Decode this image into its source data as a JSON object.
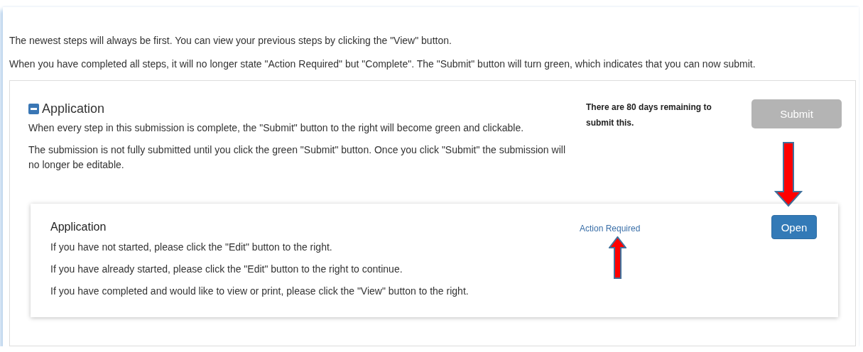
{
  "intro": [
    "The newest steps will always be first. You can view your previous steps by clicking the \"View\" button.",
    "When you have completed all steps, it will no longer state \"Action Required\" but \"Complete\". The \"Submit\" button will turn green, which indicates that you can now submit."
  ],
  "section": {
    "title": "Application",
    "expanded": true,
    "paragraphs": [
      "When every step in this submission is complete, the \"Submit\" button to the right will become green and clickable.",
      "The submission is not fully submitted until you click the green \"Submit\" button. Once you click \"Submit\" the submission will no longer be editable."
    ],
    "remaining": "There are 80 days remaining to submit this.",
    "submit": {
      "label": "Submit",
      "disabled": true
    }
  },
  "step": {
    "title": "Application",
    "lines": [
      "If you have not started, please click the \"Edit\" button to the right.",
      "If you have already started, please click the \"Edit\" button to the right to continue.",
      "If you have completed and would like to view or print, please click the \"View\" button to the right."
    ],
    "status": "Action Required",
    "button": "Open"
  }
}
